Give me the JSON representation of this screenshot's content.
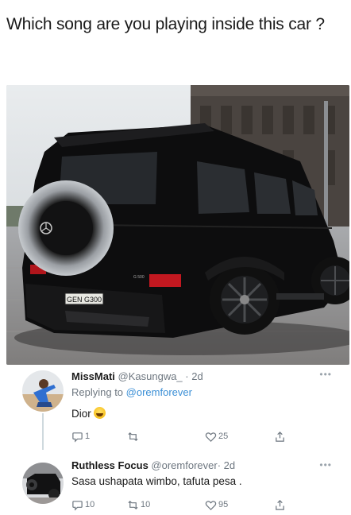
{
  "caption": "Which song are you playing inside this car ?",
  "photo": {
    "plate_text": "GEN G300",
    "badge_text": "G 500"
  },
  "tweets": [
    {
      "name": "MissMati",
      "handle": "@Kasungwa_",
      "separator": "·",
      "time": "2d",
      "replying_prefix": "Replying to ",
      "replying_to": "@oremforever",
      "text": "Dior",
      "emoji": "laughing-face",
      "reply_count": "1",
      "retweet_count": "",
      "like_count": "25"
    },
    {
      "name": "Ruthless Focus",
      "handle": "@oremforever",
      "separator": "·",
      "time": "2d",
      "text": "Sasa ushapata wimbo, tafuta pesa .",
      "reply_count": "10",
      "retweet_count": "10",
      "like_count": "95"
    }
  ],
  "colors": {
    "link": "#3b8fd6",
    "muted": "#6e7780",
    "thread_line": "#cfd9de"
  }
}
